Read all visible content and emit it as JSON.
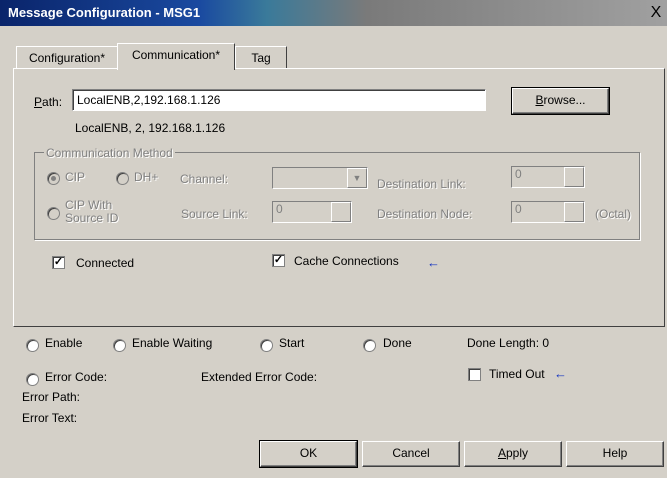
{
  "window": {
    "title": "Message Configuration - MSG1",
    "close_glyph": "X"
  },
  "tabs": [
    {
      "label": "Configuration*"
    },
    {
      "label": "Communication*"
    },
    {
      "label": "Tag"
    }
  ],
  "communication": {
    "path_label": "Path:",
    "path_value": "LocalENB,2,192.168.1.126",
    "path_resolved": "LocalENB, 2, 192.168.1.126",
    "browse_label": "Browse...",
    "method_group_label": "Communication Method",
    "method_cip_label": "CIP",
    "method_dhplus_label": "DH+",
    "method_cip_source_line1": "CIP With",
    "method_cip_source_line2": "Source ID",
    "channel_label": "Channel:",
    "channel_value": "",
    "destination_link_label": "Destination Link:",
    "destination_link_value": "0",
    "source_link_label": "Source Link:",
    "source_link_value": "0",
    "destination_node_label": "Destination Node:",
    "destination_node_value": "0",
    "octal_label": "(Octal)",
    "connected_label": "Connected",
    "connected_checked": true,
    "cache_label": "Cache Connections",
    "cache_checked": true
  },
  "status": {
    "enable_label": "Enable",
    "enable_waiting_label": "Enable Waiting",
    "start_label": "Start",
    "done_label": "Done",
    "done_length_label": "Done Length: 0",
    "error_code_label": "Error Code:",
    "extended_error_label": "Extended Error Code:",
    "timed_out_label": "Timed Out",
    "timed_out_checked": false,
    "error_path_label": "Error Path:",
    "error_text_label": "Error Text:"
  },
  "buttons": {
    "ok": "OK",
    "cancel": "Cancel",
    "apply": "Apply",
    "help": "Help"
  },
  "icons": {
    "arrow": "left-arrow-icon",
    "check": "checkmark-icon"
  }
}
